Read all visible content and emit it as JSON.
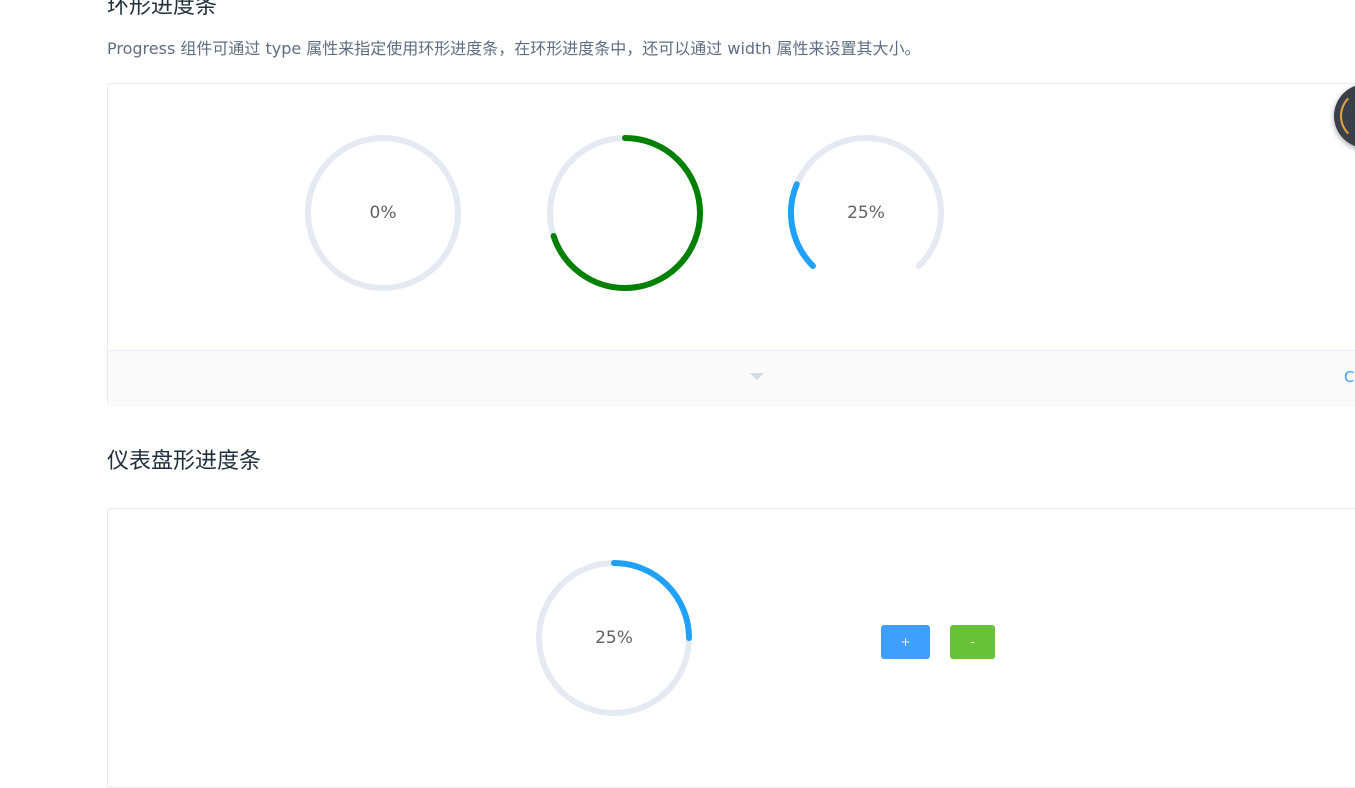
{
  "section1": {
    "title": "环形进度条",
    "description": "Progress 组件可通过 type 属性来指定使用环形进度条，在环形进度条中，还可以通过 width 属性来设置其大小。",
    "circles": [
      {
        "percentage": 0,
        "label": "0%",
        "color": "#409eff",
        "type": "circle"
      },
      {
        "percentage": 70,
        "label": "",
        "color": "#008000",
        "type": "circle"
      },
      {
        "percentage": 25,
        "label": "25%",
        "color": "#20a0ff",
        "type": "dashboard"
      }
    ],
    "control_extra_text": "C"
  },
  "section2": {
    "title": "仪表盘形进度条",
    "circle": {
      "percentage": 25,
      "label": "25%",
      "color": "#20a0ff",
      "type": "circle"
    },
    "plus_label": "+",
    "minus_label": "-"
  },
  "colors": {
    "track": "#e5e9f2",
    "primary": "#409eff",
    "success": "#67c23a"
  },
  "icons": {
    "caret": "caret-down-icon",
    "widget": "floating-widget-icon"
  }
}
